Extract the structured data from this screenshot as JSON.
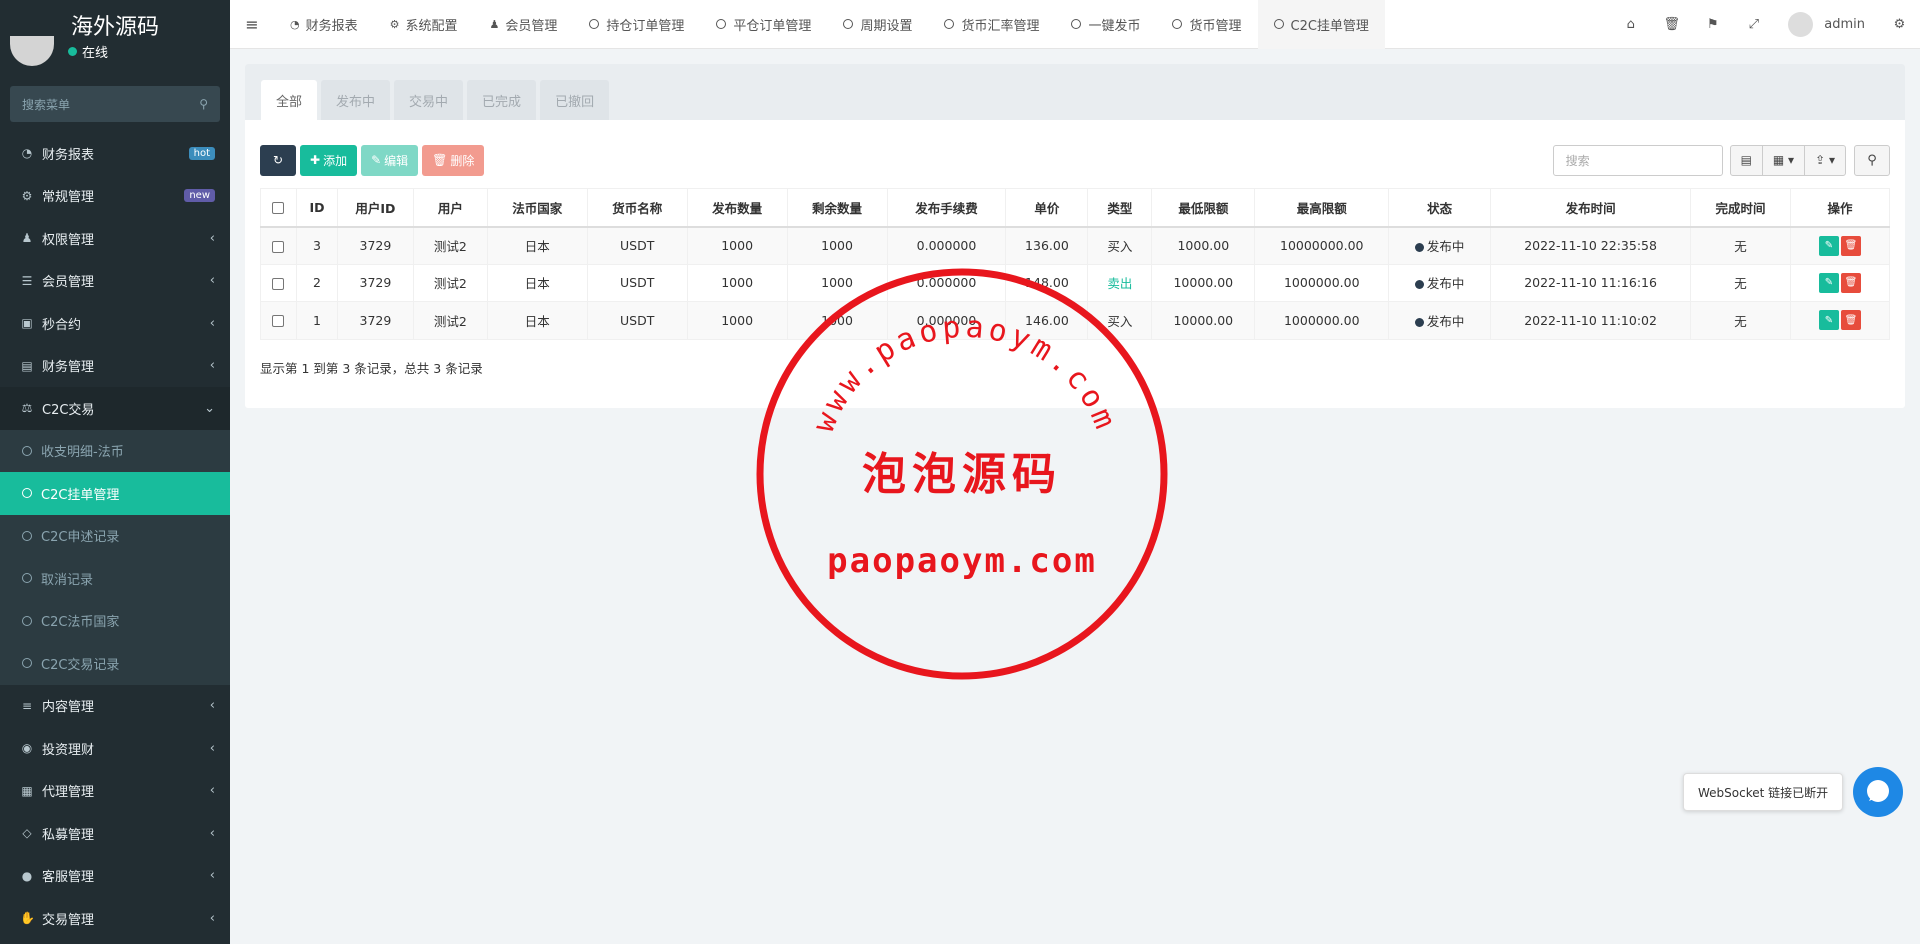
{
  "app": {
    "title": "海外源码",
    "status": "在线",
    "search_placeholder": "搜索菜单"
  },
  "sidebar": {
    "items": [
      {
        "label": "财务报表",
        "icon": "dashboard-icon",
        "badge": "hot"
      },
      {
        "label": "常规管理",
        "icon": "cogs-icon",
        "badge": "new"
      },
      {
        "label": "权限管理",
        "icon": "group-icon",
        "chevron": "‹"
      },
      {
        "label": "会员管理",
        "icon": "list-icon",
        "chevron": "‹"
      },
      {
        "label": "秒合约",
        "icon": "calendar-icon",
        "chevron": "‹"
      },
      {
        "label": "财务管理",
        "icon": "database-icon",
        "chevron": "‹"
      },
      {
        "label": "C2C交易",
        "icon": "balance-scale-icon",
        "chevron": "⌄"
      }
    ],
    "submenu": [
      {
        "label": "收支明细-法币"
      },
      {
        "label": "C2C挂单管理"
      },
      {
        "label": "C2C申述记录"
      },
      {
        "label": "取消记录"
      },
      {
        "label": "C2C法币国家"
      },
      {
        "label": "C2C交易记录"
      }
    ],
    "items_after": [
      {
        "label": "内容管理",
        "icon": "align-left-icon",
        "chevron": "‹"
      },
      {
        "label": "投资理财",
        "icon": "compass-icon",
        "chevron": "‹"
      },
      {
        "label": "代理管理",
        "icon": "suitcase-icon",
        "chevron": "‹"
      },
      {
        "label": "私募管理",
        "icon": "diamond-icon",
        "chevron": "‹"
      },
      {
        "label": "客服管理",
        "icon": "comment-icon",
        "chevron": "‹"
      },
      {
        "label": "交易管理",
        "icon": "handshake-icon",
        "chevron": "‹"
      }
    ]
  },
  "topbar": {
    "tabs": [
      {
        "label": "财务报表",
        "icon": "dashboard-icon"
      },
      {
        "label": "系统配置",
        "icon": "cog-icon"
      },
      {
        "label": "会员管理",
        "icon": "user-icon"
      },
      {
        "label": "持仓订单管理",
        "icon": "circle-o-icon"
      },
      {
        "label": "平仓订单管理",
        "icon": "circle-o-icon"
      },
      {
        "label": "周期设置",
        "icon": "circle-o-icon"
      },
      {
        "label": "货币汇率管理",
        "icon": "circle-o-icon"
      },
      {
        "label": "一键发币",
        "icon": "circle-o-icon"
      },
      {
        "label": "货币管理",
        "icon": "circle-o-icon"
      },
      {
        "label": "C2C挂单管理",
        "icon": "circle-o-icon"
      }
    ],
    "user": "admin"
  },
  "panel": {
    "filter_tabs": [
      "全部",
      "发布中",
      "交易中",
      "已完成",
      "已撤回"
    ],
    "buttons": {
      "add": "添加",
      "edit": "编辑",
      "delete": "删除"
    },
    "search_placeholder": "搜索",
    "columns": [
      "ID",
      "用户ID",
      "用户",
      "法币国家",
      "货币名称",
      "发布数量",
      "剩余数量",
      "发布手续费",
      "单价",
      "类型",
      "最低限额",
      "最高限额",
      "状态",
      "发布时间",
      "完成时间",
      "操作"
    ],
    "rows": [
      {
        "id": "3",
        "uid": "3729",
        "user": "测试2",
        "country": "日本",
        "coin": "USDT",
        "qty": "1000",
        "remain": "1000",
        "fee": "0.000000",
        "price": "136.00",
        "type": "买入",
        "min": "1000.00",
        "max": "10000000.00",
        "status": "发布中",
        "time": "2022-11-10 22:35:58",
        "done": "无"
      },
      {
        "id": "2",
        "uid": "3729",
        "user": "测试2",
        "country": "日本",
        "coin": "USDT",
        "qty": "1000",
        "remain": "1000",
        "fee": "0.000000",
        "price": "148.00",
        "type": "卖出",
        "min": "10000.00",
        "max": "1000000.00",
        "status": "发布中",
        "time": "2022-11-10 11:16:16",
        "done": "无"
      },
      {
        "id": "1",
        "uid": "3729",
        "user": "测试2",
        "country": "日本",
        "coin": "USDT",
        "qty": "1000",
        "remain": "1000",
        "fee": "0.000000",
        "price": "146.00",
        "type": "买入",
        "min": "10000.00",
        "max": "1000000.00",
        "status": "发布中",
        "time": "2022-11-10 11:10:02",
        "done": "无"
      }
    ],
    "pager_info": "显示第 1 到第 3 条记录，总共 3 条记录"
  },
  "watermark": {
    "arc_text": "www.paopaoym.com",
    "center_text": "泡泡源码",
    "bottom_text": "paopaoym.com",
    "color": "#e8161d"
  },
  "toast": {
    "text": "WebSocket 链接已断开"
  }
}
